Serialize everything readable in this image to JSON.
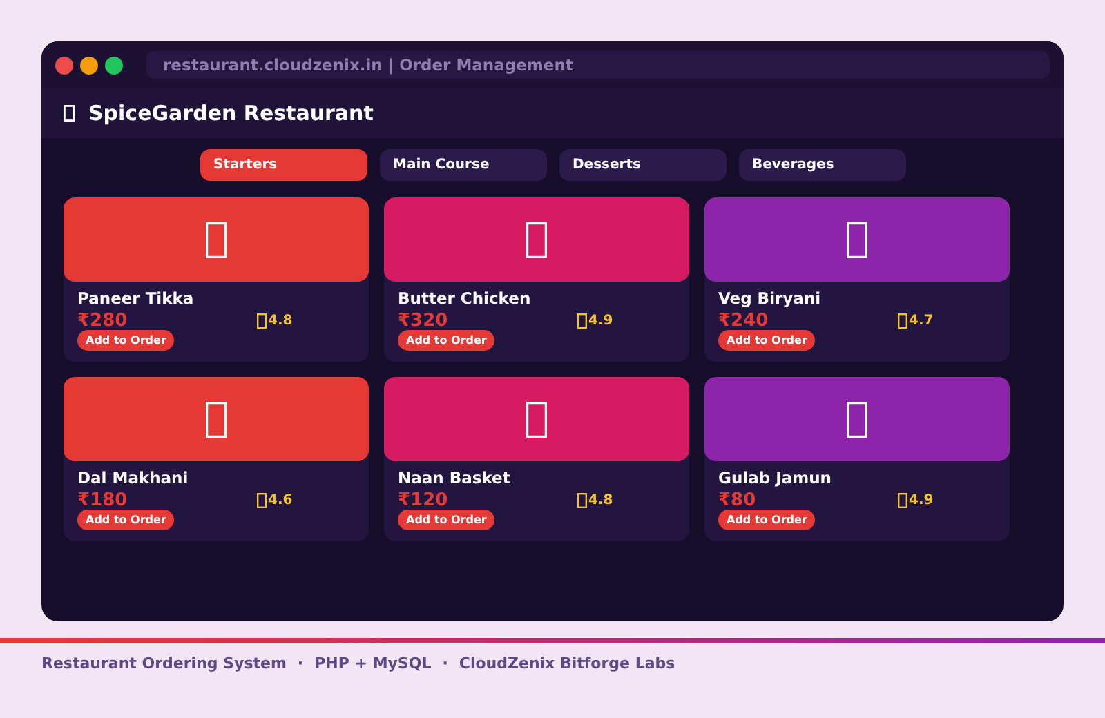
{
  "window": {
    "address": "restaurant.cloudzenix.in | Order Management"
  },
  "header": {
    "title": "SpiceGarden Restaurant"
  },
  "tabs": [
    {
      "label": "Starters",
      "selected": true
    },
    {
      "label": "Main Course",
      "selected": false
    },
    {
      "label": "Desserts",
      "selected": false
    },
    {
      "label": "Beverages",
      "selected": false
    }
  ],
  "dishes": [
    {
      "name": "Paneer Tikka",
      "price": "₹280",
      "rating": "4.8",
      "color": "#e53935",
      "button": "Add to Order"
    },
    {
      "name": "Butter Chicken",
      "price": "₹320",
      "rating": "4.9",
      "color": "#d81b60",
      "button": "Add to Order"
    },
    {
      "name": "Veg Biryani",
      "price": "₹240",
      "rating": "4.7",
      "color": "#8e24aa",
      "button": "Add to Order"
    },
    {
      "name": "Dal Makhani",
      "price": "₹180",
      "rating": "4.6",
      "color": "#e53935",
      "button": "Add to Order"
    },
    {
      "name": "Naan Basket",
      "price": "₹120",
      "rating": "4.8",
      "color": "#d81b60",
      "button": "Add to Order"
    },
    {
      "name": "Gulab Jamun",
      "price": "₹80",
      "rating": "4.9",
      "color": "#8e24aa",
      "button": "Add to Order"
    }
  ],
  "footer": {
    "parts": [
      "Restaurant Ordering System",
      "PHP + MySQL",
      "CloudZenix Bitforge Labs"
    ],
    "separator": "·"
  }
}
